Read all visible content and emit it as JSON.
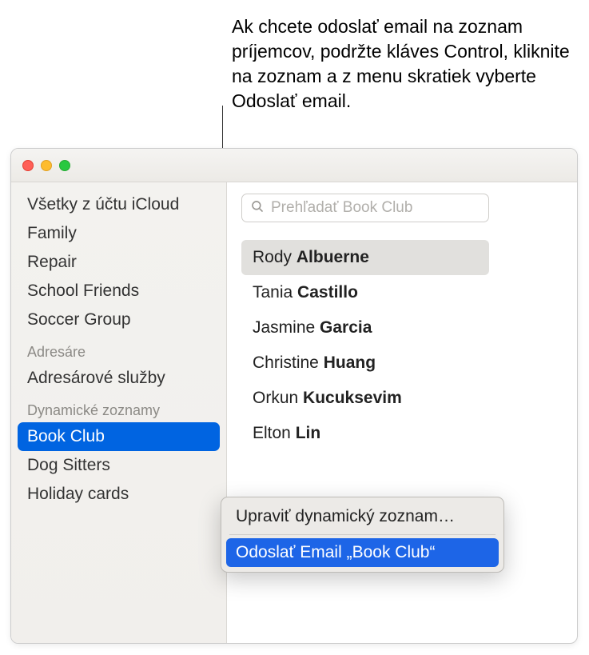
{
  "annotation": "Ak chcete odoslať email na zoznam príjemcov, podržte kláves Control, kliknite na zoznam a z menu skratiek vyberte Odoslať email.",
  "sidebar": {
    "items_top": [
      "Všetky z účtu iCloud",
      "Family",
      "Repair",
      "School Friends",
      "Soccer Group"
    ],
    "section_directories_label": "Adresáre",
    "directories": [
      "Adresárové služby"
    ],
    "section_dynamic_label": "Dynamické zoznamy",
    "dynamic_lists": [
      "Book Club",
      "Dog Sitters",
      "Holiday cards"
    ],
    "selected_dynamic": "Book Club"
  },
  "search": {
    "placeholder": "Prehľadať Book Club"
  },
  "contacts": [
    {
      "first": "Rody",
      "last": "Albuerne",
      "selected": true
    },
    {
      "first": "Tania",
      "last": "Castillo",
      "selected": false
    },
    {
      "first": "Jasmine",
      "last": "Garcia",
      "selected": false
    },
    {
      "first": "Christine",
      "last": "Huang",
      "selected": false
    },
    {
      "first": "Orkun",
      "last": "Kucuksevim",
      "selected": false
    },
    {
      "first": "Elton",
      "last": "Lin",
      "selected": false
    }
  ],
  "context_menu": {
    "edit_label": "Upraviť dynamický zoznam…",
    "send_label": "Odoslať Email „Book Club“"
  }
}
